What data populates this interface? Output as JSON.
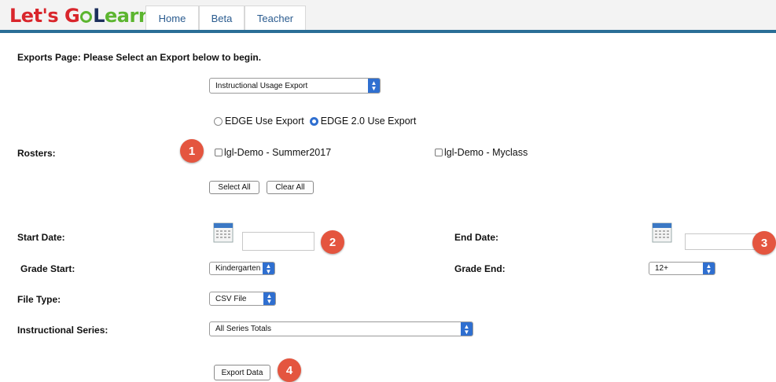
{
  "header": {
    "logo": {
      "part1": "Let's G",
      "part2": "L",
      "part3": "earn"
    },
    "tabs": [
      "Home",
      "Beta",
      "Teacher"
    ]
  },
  "page": {
    "title": "Exports Page: Please Select an Export below to begin.",
    "export_select": "Instructional Usage Export",
    "radios": {
      "edge": "EDGE Use Export",
      "edge2": "EDGE 2.0 Use Export"
    },
    "rosters": {
      "label": "Rosters:",
      "items": [
        "lgl-Demo - Summer2017",
        "lgl-Demo - Myclass"
      ],
      "select_all": "Select All",
      "clear_all": "Clear All"
    },
    "start_date_label": "Start Date:",
    "end_date_label": "End Date:",
    "grade_start_label": "Grade Start:",
    "grade_start_value": "Kindergarten",
    "grade_end_label": "Grade End:",
    "grade_end_value": "12+",
    "file_type_label": "File Type:",
    "file_type_value": "CSV File",
    "series_label": "Instructional Series:",
    "series_value": "All Series Totals",
    "export_button": "Export Data"
  },
  "annotations": [
    "1",
    "2",
    "3",
    "4"
  ],
  "colors": {
    "accent": "#2f6fd0",
    "badge": "#e4553f",
    "header_bar": "#2a6e96"
  }
}
